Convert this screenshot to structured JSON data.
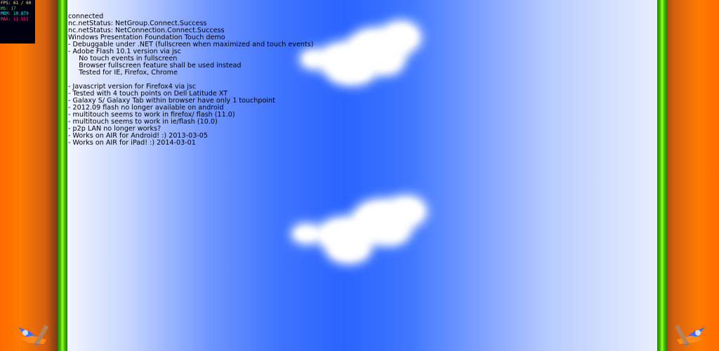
{
  "stats": {
    "fps": "FPS: 61 / 60",
    "ms": "MS: 17",
    "mem": "MEM: 10.879",
    "max": "MAX: 11.551"
  },
  "log_lines": [
    "connected",
    "nc.netStatus: NetGroup.Connect.Success",
    "nc.netStatus: NetConnection.Connect.Success",
    "Windows Presentation Foundation Touch demo",
    "- Debuggable under .NET (fullscreen when maximized and touch events)",
    "- Adobe Flash 10.1 version via jsc",
    "     No touch events in fullscreen",
    "     Browser fullscreen feature shall be used instead",
    "     Tested for IE, Firefox, Chrome",
    "",
    "- Javascript version for Firefox4 via jsc",
    "- Tested with 4 touch points on Dell Latitude XT",
    "- Galaxy S/ Galaxy Tab within browser have only 1 touchpoint",
    "- 2012.09 flash no longer available on android",
    "- multitouch seems to work in firefox/ flash (11.0)",
    "- multitouch seems to work in ie/flash (10.0)",
    "- p2p LAN no longer works?",
    "- Works on AIR for Android! :) 2013-03-05",
    "- Works on AIR for iPad! :) 2014-03-01"
  ],
  "colors": {
    "side_orange": "#ff6a00",
    "rail_green": "#45c200",
    "sky_blue": "#2a64ff"
  },
  "icons": {
    "left_logo": "airplane-icon",
    "right_logo": "airplane-icon"
  }
}
